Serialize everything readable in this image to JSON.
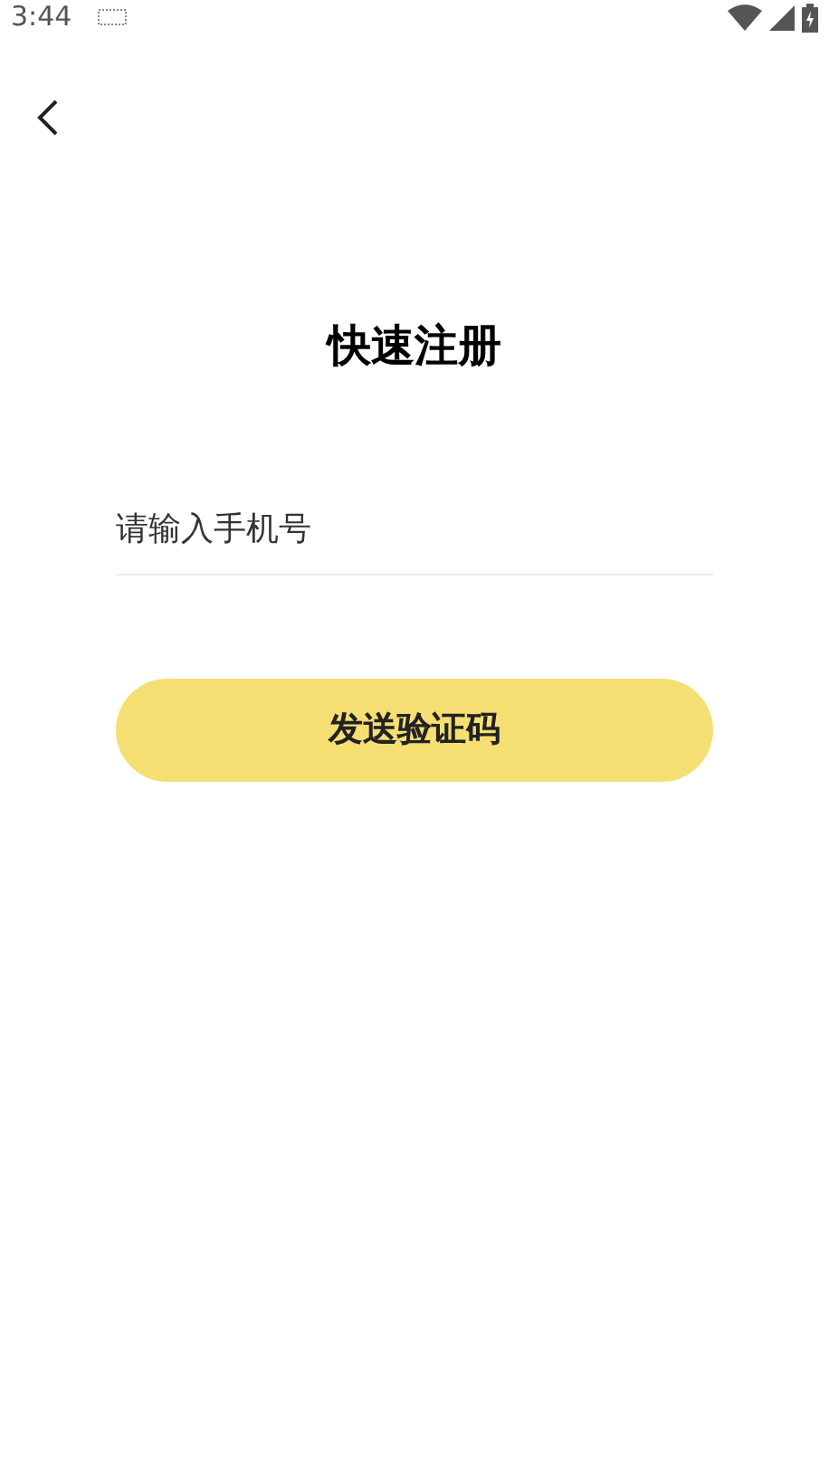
{
  "status_bar": {
    "time": "3:44"
  },
  "title": "快速注册",
  "phone_field": {
    "placeholder": "请输入手机号"
  },
  "submit_button": {
    "label": "发送验证码"
  }
}
